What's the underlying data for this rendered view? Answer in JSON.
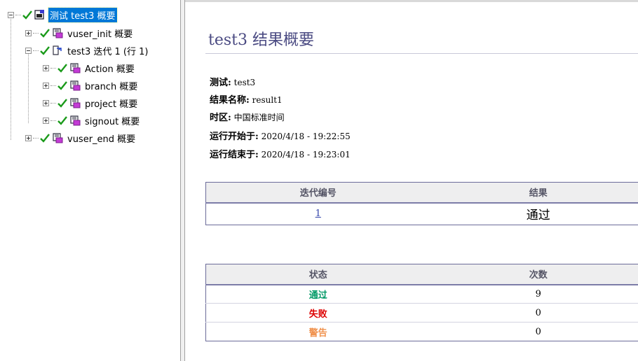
{
  "tree": {
    "root_label": "测试 test3 概要",
    "vuser_init_label": "vuser_init 概要",
    "iteration_label": "test3 迭代 1 (行 1)",
    "action_label": "Action 概要",
    "branch_label": "branch 概要",
    "project_label": "project 概要",
    "signout_label": "signout 概要",
    "vuser_end_label": "vuser_end 概要"
  },
  "summary": {
    "title": "test3 结果概要",
    "test_label": "测试:",
    "test_value": "test3",
    "result_name_label": "结果名称:",
    "result_name_value": "result1",
    "timezone_label": "时区:",
    "timezone_value": "中国标准时间",
    "start_label": "运行开始于:",
    "start_value": "2020/4/18 - 19:22:55",
    "end_label": "运行结束于:",
    "end_value": "2020/4/18 - 19:23:01"
  },
  "iterations": {
    "headers": [
      "迭代编号",
      "结果"
    ],
    "rows": [
      {
        "number": "1",
        "result": "通过"
      }
    ]
  },
  "status": {
    "headers": [
      "状态",
      "次数"
    ],
    "rows": [
      {
        "name": "通过",
        "count": "9",
        "color": "#009966"
      },
      {
        "name": "失败",
        "count": "0",
        "color": "#dd0000"
      },
      {
        "name": "警告",
        "count": "0",
        "color": "#f0924e"
      }
    ]
  },
  "icons": {
    "check": "check-icon",
    "script": "script-icon",
    "iteration": "iteration-icon",
    "test": "test-icon"
  }
}
